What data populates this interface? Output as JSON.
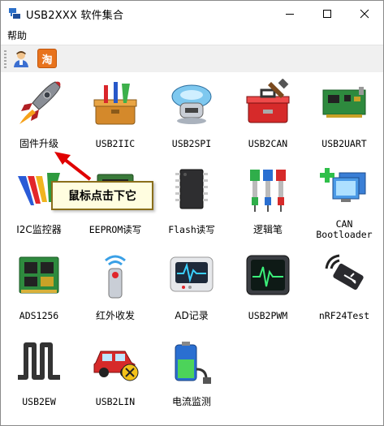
{
  "window": {
    "title": "USB2XXX 软件集合"
  },
  "menu": {
    "help": "帮助"
  },
  "toolbar": {
    "user_icon": "user-icon",
    "taobao_label": "淘"
  },
  "items": [
    {
      "label": "固件升级",
      "icon": "rocket-icon"
    },
    {
      "label": "USB2IIC",
      "icon": "toolbox-icon"
    },
    {
      "label": "USB2SPI",
      "icon": "robot-icon"
    },
    {
      "label": "USB2CAN",
      "icon": "red-toolbox-icon"
    },
    {
      "label": "USB2UART",
      "icon": "circuit-board-icon"
    },
    {
      "label": "I2C监控器",
      "icon": "waveform-icon"
    },
    {
      "label": "EEPROM读写",
      "icon": "eeprom-chip-icon"
    },
    {
      "label": "Flash读写",
      "icon": "flash-chip-icon"
    },
    {
      "label": "逻辑笔",
      "icon": "probes-icon"
    },
    {
      "label": "CAN\nBootloader",
      "icon": "screens-icon"
    },
    {
      "label": "ADS1256",
      "icon": "ram-module-icon"
    },
    {
      "label": "红外收发",
      "icon": "remote-control-icon"
    },
    {
      "label": "AD记录",
      "icon": "monitor-waveform-icon"
    },
    {
      "label": "USB2PWM",
      "icon": "oscilloscope-icon"
    },
    {
      "label": "nRF24Test",
      "icon": "usb-wireless-icon"
    },
    {
      "label": "USB2EW",
      "icon": "square-wave-icon"
    },
    {
      "label": "USB2LIN",
      "icon": "car-repair-icon"
    },
    {
      "label": "电流监测",
      "icon": "battery-plug-icon"
    }
  ],
  "callout": {
    "text": "鼠标点击下它"
  },
  "colors": {
    "callout_bg": "#fffde0",
    "callout_border": "#8a6e1a",
    "arrow": "#e00000"
  }
}
